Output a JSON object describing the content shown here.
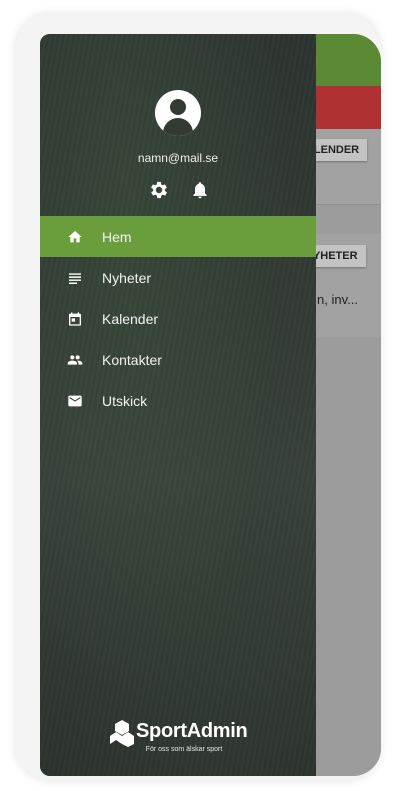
{
  "app": {
    "calendar_button": "KALENDER",
    "news_button": "NYHETER",
    "news_snippet": "n, inv..."
  },
  "drawer": {
    "email": "namn@mail.se",
    "nav": [
      {
        "label": "Hem",
        "icon": "home-icon",
        "active": true
      },
      {
        "label": "Nyheter",
        "icon": "news-icon",
        "active": false
      },
      {
        "label": "Kalender",
        "icon": "calendar-icon",
        "active": false
      },
      {
        "label": "Kontakter",
        "icon": "contacts-icon",
        "active": false
      },
      {
        "label": "Utskick",
        "icon": "mail-icon",
        "active": false
      }
    ],
    "brand": {
      "name": "SportAdmin",
      "tagline": "För oss som älskar sport"
    }
  },
  "colors": {
    "accent_green": "#6a9e3c",
    "drawer_bg": "#323a33",
    "header_red": "#b03131"
  }
}
